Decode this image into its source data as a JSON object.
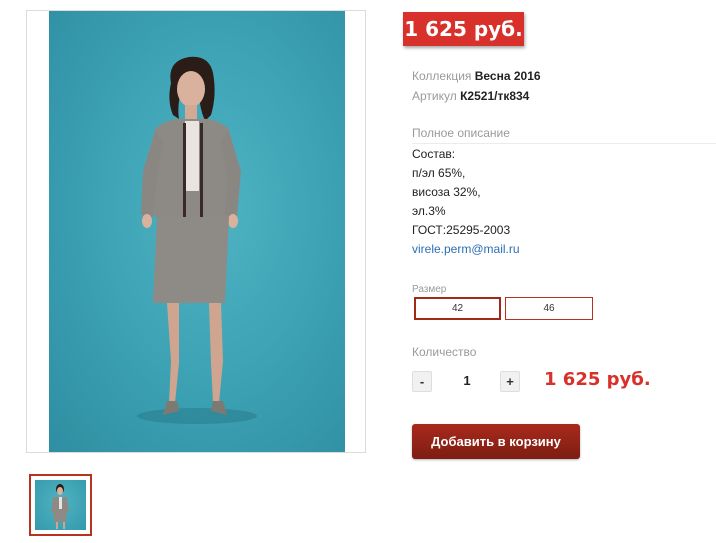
{
  "product": {
    "price_badge": "1 625 руб.",
    "collection_key": "Коллекция",
    "collection_value": "Весна 2016",
    "article_key": "Артикул",
    "article_value": "К2521/тк834"
  },
  "description": {
    "heading": "Полное описание",
    "lines": [
      "Состав:",
      "п/эл 65%,",
      "висоза 32%,",
      "эл.3%",
      "ГОСТ:25295-2003"
    ],
    "email": "virele.perm@mail.ru"
  },
  "sizes": {
    "label": "Размер",
    "options": [
      "42",
      "46"
    ],
    "selected": "42"
  },
  "quantity": {
    "label": "Количество",
    "minus": "-",
    "value": "1",
    "plus": "+",
    "total": "1 625 руб."
  },
  "cart": {
    "add_label": "Добавить в корзину"
  },
  "colors": {
    "accent_red": "#d8302a",
    "button_dark_red": "#8a2116",
    "photo_background": "#3ea4b6"
  }
}
